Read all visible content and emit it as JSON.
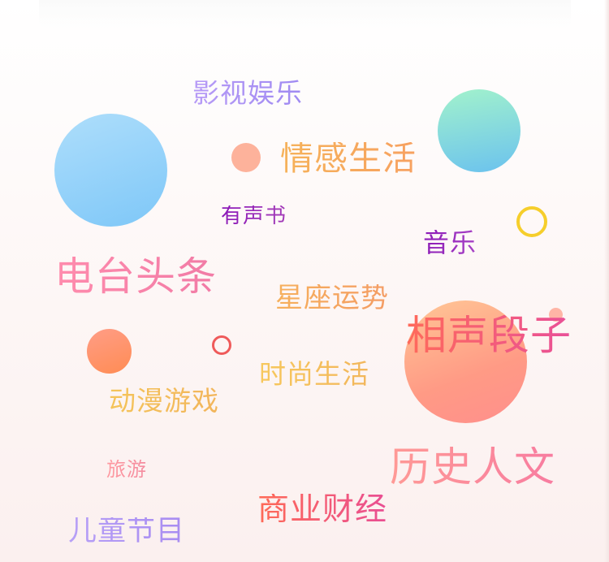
{
  "theme": {
    "blue_bubble": [
      "#a9dcfb",
      "#7cc6f7"
    ],
    "teal_bubble": [
      "#9ef0cf",
      "#6cc3ec"
    ],
    "salmon_dot": "#fdb29b",
    "orange_bubble": [
      "#ffa37e",
      "#ff8c5c"
    ],
    "big_peach_bubble": [
      "#ffc494",
      "#ff8d86"
    ],
    "yellow_ring": "#f6ce2b",
    "red_ring": "#ef5a5a",
    "pink_dot": "#ffb5a6"
  },
  "categories": {
    "film": "影视娱乐",
    "emotion": "情感生活",
    "audiobook": "有声书",
    "music": "音乐",
    "radio": "电台头条",
    "horoscope": "星座运势",
    "crosstalk": "相声段子",
    "fashion": "时尚生活",
    "anime": "动漫游戏",
    "travel": "旅游",
    "history": "历史人文",
    "business": "商业财经",
    "kids": "儿童节目"
  }
}
